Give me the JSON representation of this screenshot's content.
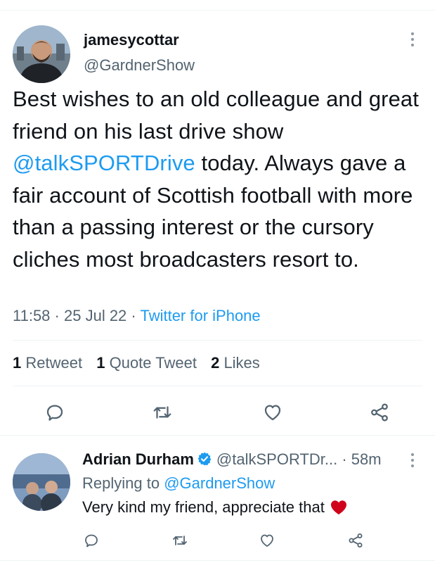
{
  "tweet": {
    "username": "jamesycottar",
    "handle": "@GardnerShow",
    "text_before": "Best wishes to an old colleague and great friend on his last drive show ",
    "mention": "@talkSPORTDrive",
    "text_after": " today. Always gave a fair account of Scottish football with more than a passing interest or the cursory cliches most broadcasters resort to.",
    "time": "11:58",
    "sep1": "·",
    "date": "25 Jul 22",
    "sep2": "·",
    "source": "Twitter for iPhone",
    "stats": {
      "retweets_count": "1",
      "retweets_label": "Retweet",
      "quotes_count": "1",
      "quotes_label": "Quote Tweet",
      "likes_count": "2",
      "likes_label": "Likes"
    }
  },
  "reply": {
    "name": "Adrian Durham",
    "handle": "@talkSPORTDr...",
    "dot": "·",
    "time": "58m",
    "replying_prefix": "Replying to",
    "replying_to": "@GardnerShow",
    "text": "Very kind my friend, appreciate that"
  },
  "icons": {
    "reply": "reply-icon",
    "retweet": "retweet-icon",
    "like": "heart-icon",
    "share": "share-icon",
    "more": "more-vertical-icon",
    "verified": "verified-badge-icon"
  },
  "colors": {
    "link": "#1d9bf0",
    "secondary_text": "#536471",
    "icon": "#536471",
    "heart_emoji": "#d0021b"
  }
}
